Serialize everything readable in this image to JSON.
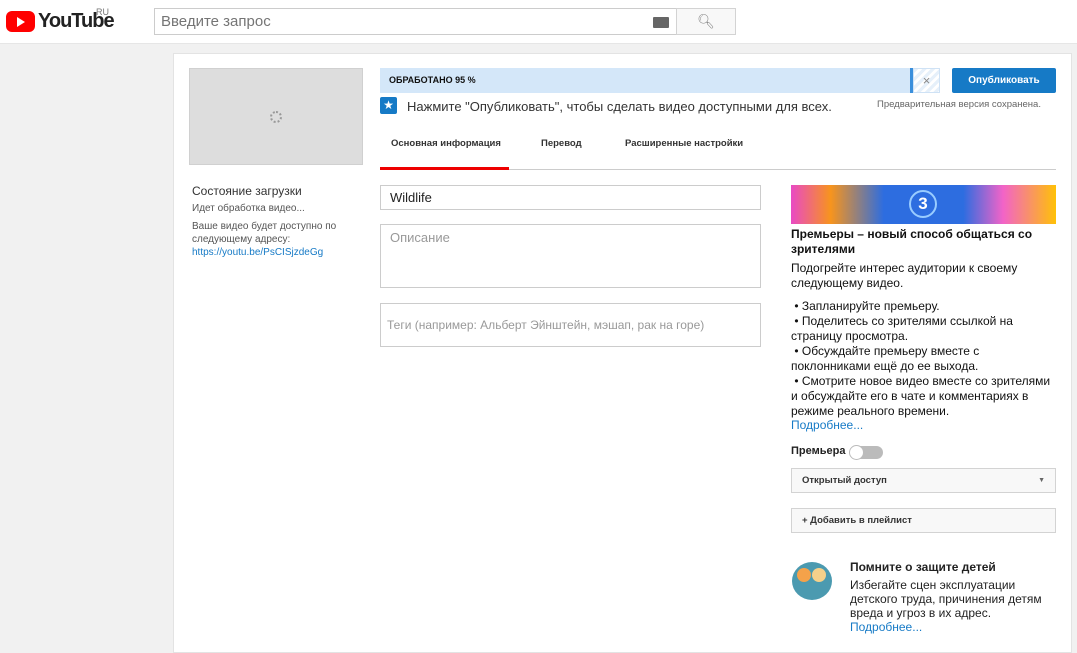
{
  "header": {
    "logo_text": "YouTube",
    "logo_region": "RU",
    "search_placeholder": "Введите запрос"
  },
  "upload": {
    "status_title": "Состояние загрузки",
    "status_text": "Идет обработка видео...",
    "url_note": "Ваше видео будет доступно по следующему адресу:",
    "url": "https://youtu.be/PsCISjzdeGg",
    "progress_label": "ОБРАБОТАНО 95 %",
    "progress_percent": 95,
    "publish_label": "Опубликовать",
    "hint": "Нажмите \"Опубликовать\", чтобы сделать видео доступными для всех.",
    "saved": "Предварительная версия сохранена."
  },
  "tabs": [
    {
      "label": "Основная информация",
      "active": true
    },
    {
      "label": "Перевод"
    },
    {
      "label": "Расширенные настройки"
    }
  ],
  "form": {
    "title_value": "Wildlife",
    "description_placeholder": "Описание",
    "tags_placeholder": "Теги (например: Альберт Эйнштейн, мэшап, рак на горе)"
  },
  "premiere": {
    "banner_number": "3",
    "title": "Премьеры – новый способ общаться со зрителями",
    "intro": "Подогрейте интерес аудитории к своему следующему видео.",
    "bullets": [
      "Запланируйте премьеру.",
      "Поделитесь со зрителями ссылкой на страницу просмотра.",
      "Обсуждайте премьеру вместе с поклонниками ещё до ее выхода.",
      "Смотрите новое видео вместе со зрителями и обсуждайте его в чате и комментариях в режиме реального времени."
    ],
    "more": "Подробнее...",
    "toggle_label": "Премьера",
    "toggle_on": false
  },
  "privacy": {
    "selected": "Открытый доступ"
  },
  "playlist_label": "+ Добавить в плейлист",
  "kids": {
    "title": "Помните о защите детей",
    "body": "Избегайте сцен эксплуатации детского труда, причинения детям вреда и угроз в их адрес.",
    "more": "Подробнее..."
  }
}
